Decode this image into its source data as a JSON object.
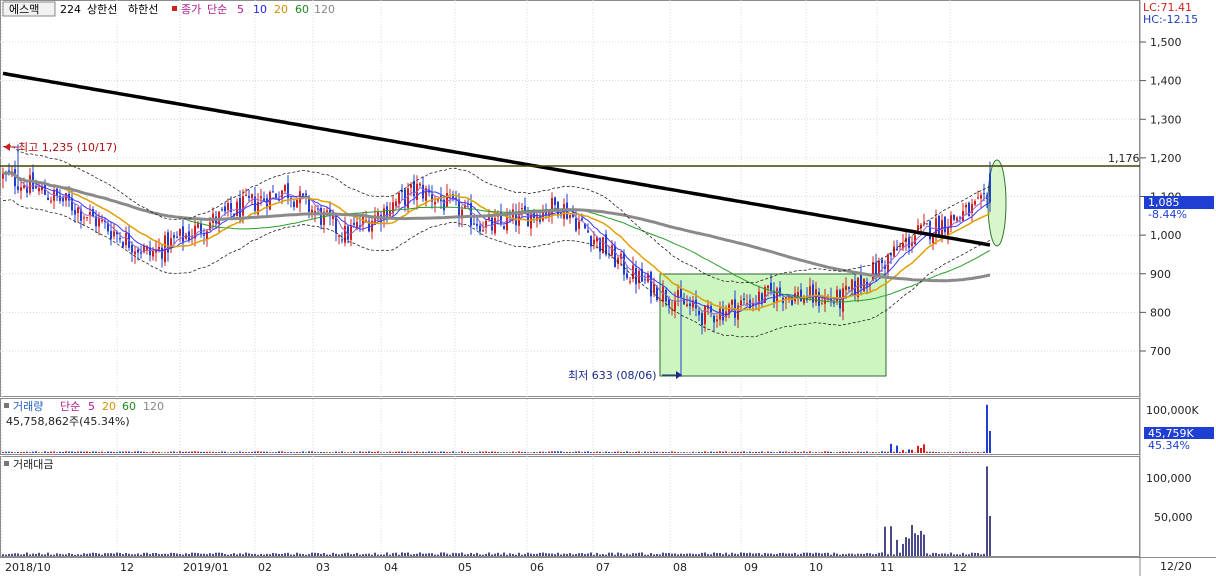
{
  "colors": {
    "up": "#d21f1f",
    "down": "#1f3fd2",
    "bg": "#ffffff",
    "grid": "#d8d8d8",
    "ma5": "#9966cc",
    "ma10": "#3a3aff",
    "ma20": "#e0a000",
    "ma60": "#2a9d2a",
    "ma120": "#8a8a8a",
    "ma224": "#000000",
    "box": "#ccf5c0"
  },
  "header": {
    "symbol": "에스맥",
    "ma224": "224",
    "upper": "상한선",
    "lower": "하한선",
    "price_label": "종가",
    "simple": "단순",
    "ma5": "5",
    "ma10": "10",
    "ma20": "20",
    "ma60": "60",
    "ma120": "120"
  },
  "top_right": {
    "lc": "LC:71.41",
    "hc": "HC:-12.15"
  },
  "annotations": {
    "high": "최고 1,235 (10/17)",
    "low": "최저 633 (08/06)",
    "resistance": "1,176",
    "current_price": "1,085",
    "current_change": "-8.44%"
  },
  "volume_panel": {
    "title": "거래량",
    "simple": "단순",
    "ma5": "5",
    "ma20": "20",
    "ma60": "60",
    "ma120": "120",
    "current": "45,758,862주(45.34%)",
    "badge_value": "45,759K",
    "badge_pct": "45.34%"
  },
  "amount_panel": {
    "title": "거래대금"
  },
  "date_right": "12/20",
  "chart_data": [
    {
      "type": "candlestick",
      "title": "에스맥",
      "y_ticks": [
        "1,500",
        "1,400",
        "1,300",
        "1,200",
        "1,100",
        "1,000",
        "900",
        "800",
        "700"
      ],
      "ylim": [
        610,
        1590
      ],
      "x_ticks": [
        "2018/10",
        "12",
        "2019/01",
        "02",
        "03",
        "04",
        "05",
        "06",
        "07",
        "08",
        "09",
        "10",
        "11",
        "12"
      ],
      "close_trend": [
        {
          "month": "2018/10",
          "close": 1150
        },
        {
          "month": "2018/11",
          "close": 1080
        },
        {
          "month": "2018/12",
          "close": 950
        },
        {
          "month": "2019/01",
          "close": 1040
        },
        {
          "month": "2019/02",
          "close": 1120
        },
        {
          "month": "2019/03",
          "close": 1000
        },
        {
          "month": "2019/04",
          "close": 1120
        },
        {
          "month": "2019/05",
          "close": 1020
        },
        {
          "month": "2019/06",
          "close": 1080
        },
        {
          "month": "2019/07",
          "close": 900
        },
        {
          "month": "2019/08",
          "close": 790
        },
        {
          "month": "2019/09",
          "close": 850
        },
        {
          "month": "2019/10",
          "close": 830
        },
        {
          "month": "2019/11",
          "close": 1000
        },
        {
          "month": "2019/12",
          "close": 1085
        }
      ],
      "high": {
        "value": 1235,
        "date": "10/17"
      },
      "low": {
        "value": 633,
        "date": "08/06"
      },
      "horizontal_line": 1176,
      "last_close": 1085
    },
    {
      "type": "bar",
      "title": "거래량",
      "y_ticks": [
        "100,000K"
      ],
      "ylim": [
        0,
        110000
      ],
      "unit": "K"
    },
    {
      "type": "bar",
      "title": "거래대금",
      "y_ticks": [
        "100,000",
        "50,000"
      ],
      "ylim": [
        0,
        120000
      ]
    }
  ]
}
